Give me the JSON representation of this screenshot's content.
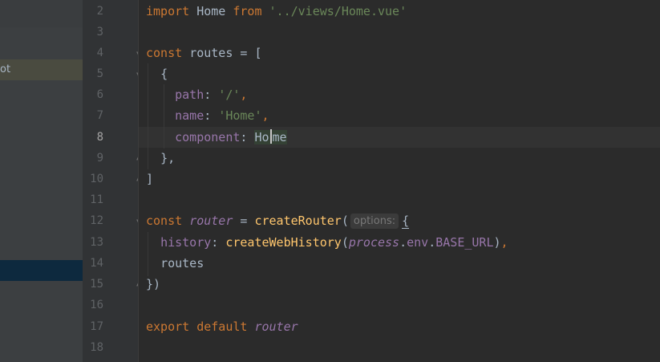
{
  "sidebar": {
    "item_root": "ot"
  },
  "gutter": {
    "line_numbers": [
      "2",
      "3",
      "4",
      "5",
      "6",
      "7",
      "8",
      "9",
      "10",
      "11",
      "12",
      "13",
      "14",
      "15",
      "16",
      "17",
      "18"
    ],
    "current_line": "8"
  },
  "code": {
    "l2": {
      "kw": "import",
      "id": "Home",
      "kw2": "from",
      "str": "'../views/Home.vue'"
    },
    "l4": {
      "kw": "const",
      "id": "routes",
      "op": "= ["
    },
    "l5": {
      "t": "{"
    },
    "l6": {
      "prop": "path",
      "sep": ":",
      "str": "'/'",
      "comma": ","
    },
    "l7": {
      "prop": "name",
      "sep": ":",
      "str": "'Home'",
      "comma": ","
    },
    "l8": {
      "prop": "component",
      "sep": ":",
      "id_a": "Ho",
      "id_b": "me"
    },
    "l9": {
      "t": "},"
    },
    "l10": {
      "t": "]"
    },
    "l12": {
      "kw": "const",
      "id": "router",
      "op": "=",
      "fn": "createRouter",
      "paren": "(",
      "hint": "options:",
      "brace": "{"
    },
    "l13": {
      "prop": "history",
      "sep": ":",
      "fn": "createWebHistory",
      "paren": "(",
      "proc": "process",
      "dot1": ".",
      "env": "env",
      "dot2": ".",
      "base": "BASE_URL",
      "close": ")",
      "comma": ","
    },
    "l14": {
      "t": "routes"
    },
    "l15": {
      "t": "})"
    },
    "l17": {
      "kw": "export",
      "kw2": "default",
      "id": "router"
    }
  }
}
